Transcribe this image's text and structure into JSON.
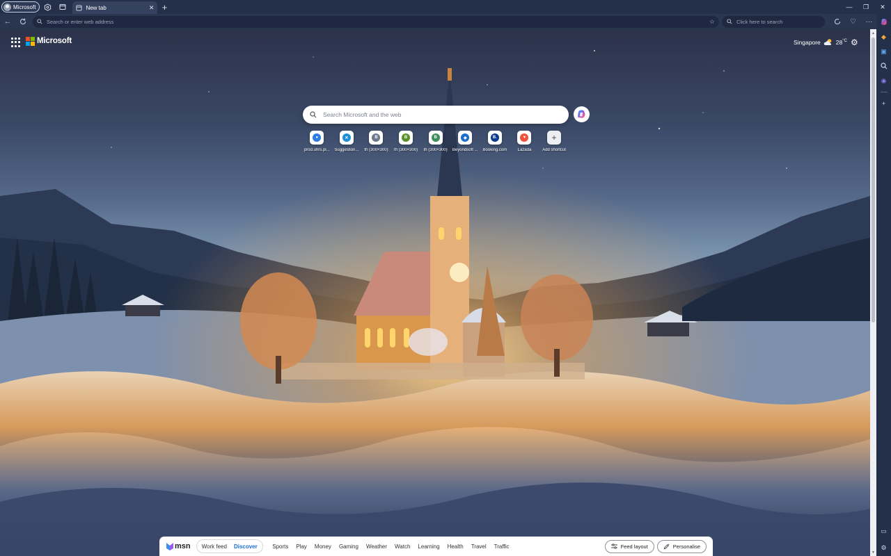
{
  "browser": {
    "profile_label": "Microsoft",
    "tab_title": "New tab",
    "address_placeholder": "Search or enter web address",
    "websearch_placeholder": "Click here to search"
  },
  "page": {
    "brand": "Microsoft",
    "weather_city": "Singapore",
    "weather_temp": "28",
    "weather_unit": "°C",
    "search_placeholder": "Search Microsoft and the web"
  },
  "shortcuts": [
    {
      "label": "prod.uhrs.pl...",
      "glyph": "●",
      "color": "#2f7be0"
    },
    {
      "label": "Suggestion...",
      "glyph": "✕",
      "color": "#1e8fd6"
    },
    {
      "label": "th (300×300)",
      "glyph": "B",
      "color": "#6c7a8e"
    },
    {
      "label": "th (300×300)",
      "glyph": "B",
      "color": "#5a8f2a"
    },
    {
      "label": "th (300×300)",
      "glyph": "B",
      "color": "#3d8f5b"
    },
    {
      "label": "Beyondsoft ...",
      "glyph": "◆",
      "color": "#1d6fc9"
    },
    {
      "label": "Booking.com",
      "glyph": "B.",
      "color": "#0b3b8c"
    },
    {
      "label": "Lazada",
      "glyph": "♥",
      "color": "#f0533c"
    },
    {
      "label": "Add shortcut",
      "glyph": "+",
      "color": "#555555"
    }
  ],
  "feed": {
    "logo": "msn",
    "seg_work": "Work feed",
    "seg_discover": "Discover",
    "categories": [
      "Sports",
      "Play",
      "Money",
      "Gaming",
      "Weather",
      "Watch",
      "Learning",
      "Health",
      "Travel",
      "Traffic"
    ],
    "layout_btn": "Feed layout",
    "personalise_btn": "Personalise"
  },
  "colors": {
    "ms_red": "#f25022",
    "ms_green": "#7fba00",
    "ms_blue": "#00a4ef",
    "ms_yellow": "#ffb900",
    "discover_active": "#1a6fd6"
  }
}
